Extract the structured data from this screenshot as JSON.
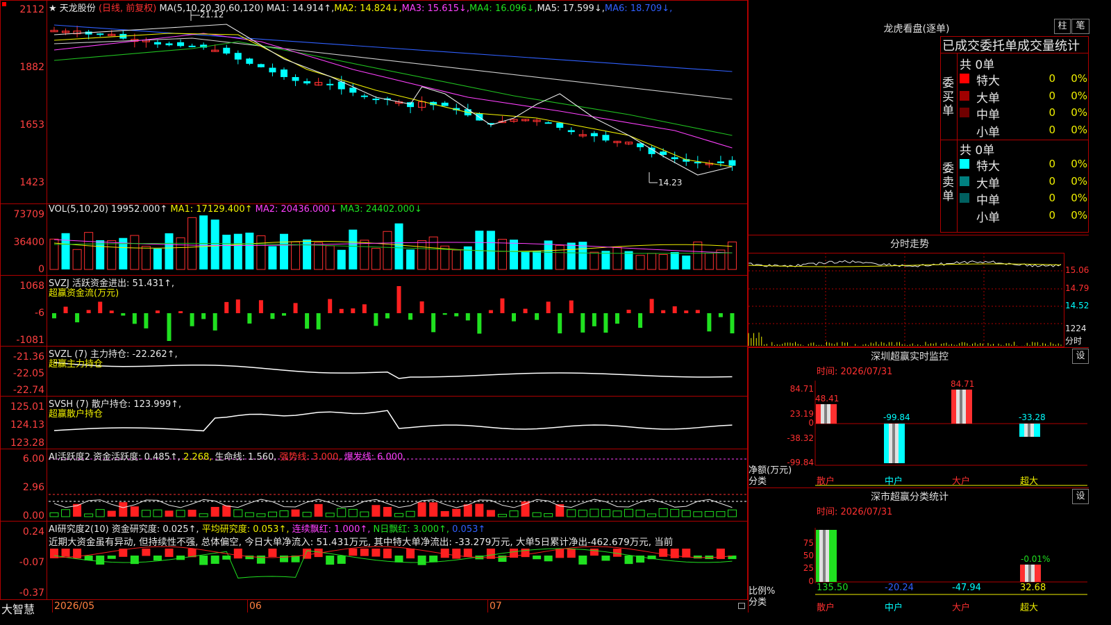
{
  "header": {
    "star": "★",
    "stock_name": "天龙股份",
    "period": "(日线, 前复权)",
    "ma_prefix": "MA(5,10,20,30,60,120)",
    "ma_items": [
      {
        "label": "MA1: 14.914↑",
        "color": "#e8e8e8"
      },
      {
        "label": "MA2: 14.824↓",
        "color": "#f0f000"
      },
      {
        "label": "MA3: 15.615↓",
        "color": "#ff40ff"
      },
      {
        "label": "MA4: 16.096↓",
        "color": "#20e020"
      },
      {
        "label": "MA5: 17.599↓",
        "color": "#e8e8e8"
      },
      {
        "label": "MA6: 18.709↓",
        "color": "#3060ff"
      }
    ],
    "high_label": "21.12",
    "low_label": "14.23"
  },
  "price_axis": [
    "2112",
    "1882",
    "1653",
    "1423"
  ],
  "vol": {
    "title": "VOL(5,10,20)",
    "value": "19952.000↑",
    "ma1": "MA1: 17129.400↑",
    "ma2": "MA2: 20436.000↓",
    "ma3": "MA3: 24402.000↓",
    "axis": [
      "73709",
      "36400",
      "0"
    ]
  },
  "svzj": {
    "title": "SVZJ  活跃资金进出: 51.431↑,",
    "subtitle": "超赢资金流(万元)",
    "axis": [
      "1068",
      "-6",
      "-1081"
    ]
  },
  "svzl": {
    "title": "SVZL (7) 主力持仓: -22.262↑,",
    "subtitle": "超赢主力持仓",
    "axis": [
      "-21.36",
      "-22.05",
      "-22.74"
    ]
  },
  "svsh": {
    "title": "SVSH (7) 散户持仓: 123.999↑,",
    "subtitle": "超赢散户持仓",
    "axis": [
      "125.01",
      "124.13",
      "123.28"
    ]
  },
  "ai1": {
    "title": "AI活跃度2 资金活跃度: 0.485↑,",
    "v2": "2.268,",
    "v3": "生命线: 1.560,",
    "v4": "强势线: 3.000,",
    "v5": "爆发线: 6.000,",
    "axis": [
      "6.00",
      "2.96",
      "0.00"
    ]
  },
  "ai2": {
    "title": "AI研究度2(10) 资金研究度: 0.025↑,",
    "v2": "平均研究度: 0.053↑,",
    "v3": "连续飘红: 1.000↑,",
    "v4": "N日飘红: 3.000↑,",
    "v5": "0.053↑",
    "comment": "近期大资金虽有异动, 但持续性不强, 总体偏空, 今日大单净流入: 51.431万元, 其中特大单净流出: -33.279万元, 大单5日累计净出-462.679万元, 当前",
    "axis": [
      "0.24",
      "-0.07",
      "-0.37"
    ]
  },
  "bottom_axis": {
    "brand": "大智慧",
    "dates": [
      "2026/05",
      "06",
      "07"
    ]
  },
  "right": {
    "dragon_title": "龙虎看盘(逐单)",
    "btn_zhu": "柱",
    "btn_bi": "笔",
    "stat_title": "已成交委托单成交量统计",
    "buy_label": "委买单",
    "sell_label": "委卖单",
    "buy_total": "共 0单",
    "sell_total": "共 0单",
    "buy_rows": [
      {
        "label": "特大",
        "count": "0",
        "pct": "0%",
        "color": "#ff0000"
      },
      {
        "label": "大单",
        "count": "0",
        "pct": "0%",
        "color": "#a00000"
      },
      {
        "label": "中单",
        "count": "0",
        "pct": "0%",
        "color": "#700000"
      },
      {
        "label": "小单",
        "count": "0",
        "pct": "0%",
        "color": "#000000"
      }
    ],
    "sell_rows": [
      {
        "label": "特大",
        "count": "0",
        "pct": "0%",
        "color": "#00ffff"
      },
      {
        "label": "大单",
        "count": "0",
        "pct": "0%",
        "color": "#008080"
      },
      {
        "label": "中单",
        "count": "0",
        "pct": "0%",
        "color": "#006060"
      },
      {
        "label": "小单",
        "count": "0",
        "pct": "0%",
        "color": "#000000"
      }
    ],
    "fenshi_title": "分时走势",
    "fenshi_axis": [
      "15.06",
      "14.79",
      "14.52",
      "1224",
      "分时"
    ],
    "monitor": {
      "title": "深圳超赢实时监控",
      "btn": "设",
      "time": "时间: 2026/07/31",
      "axis": [
        "84.71",
        "23.19",
        "0",
        "-38.32",
        "-99.84"
      ],
      "unit1": "净额(万元)",
      "unit2": "分类",
      "cats": [
        "散户",
        "中户",
        "大户",
        "超大"
      ],
      "values": [
        48.41,
        -99.84,
        84.71,
        -33.28
      ],
      "value_labels": [
        "48.41",
        "-99.84",
        "84.71",
        "-33.28"
      ]
    },
    "classify": {
      "title": "深市超赢分类统计",
      "btn": "设",
      "time": "时间: 2026/07/31",
      "axis": [
        "75",
        "50",
        "25",
        "0"
      ],
      "unit1": "比例%",
      "unit2": "分类",
      "cats": [
        "散户",
        "中户",
        "大户",
        "超大"
      ],
      "bottom_values": [
        "135.50",
        "-20.24",
        "-47.94",
        "32.68"
      ],
      "bar_label": "-0.01%"
    }
  },
  "colors": {
    "up": "#ff3030",
    "down": "#00ffff",
    "frame": "#b00000"
  }
}
